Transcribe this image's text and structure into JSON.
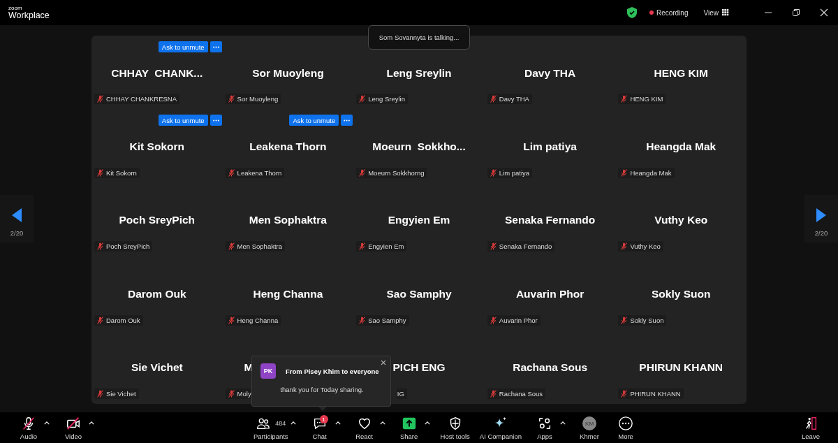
{
  "app": {
    "logo_small": "zoom",
    "logo": "Workplace"
  },
  "top_bar": {
    "secure": true,
    "recording": {
      "label": "Recording",
      "on": true
    },
    "view": "View"
  },
  "talking": "Som Sovannyta is talking...",
  "pager": {
    "left": "2/20",
    "right": "2/20"
  },
  "tiles": [
    {
      "name": "CHHAY  CHANK...",
      "label": "CHHAY CHANKRESNA",
      "muted": true,
      "ask": "Ask to unmute"
    },
    {
      "name": "Sor Muoyleng",
      "label": "Sor Muoyleng",
      "muted": true
    },
    {
      "name": "Leng Sreylin",
      "label": "Leng Sreylin",
      "muted": true
    },
    {
      "name": "Davy THA",
      "label": "Davy THA",
      "muted": true
    },
    {
      "name": "HENG KIM",
      "label": "HENG KIM",
      "muted": true
    },
    {
      "name": "Kit Sokorn",
      "label": "Kit Sokorn",
      "muted": true,
      "ask": "Ask to unmute"
    },
    {
      "name": "Leakena Thorn",
      "label": "Leakena Thorn",
      "muted": true,
      "ask": "Ask to unmute"
    },
    {
      "name": "Moeurn  Sokkho...",
      "label": "Moeurn Sokkhorng",
      "muted": true
    },
    {
      "name": "Lim patiya",
      "label": "Lim patiya",
      "muted": true
    },
    {
      "name": "Heangda Mak",
      "label": "Heangda Mak",
      "muted": true
    },
    {
      "name": "Poch SreyPich",
      "label": "Poch SreyPich",
      "muted": true
    },
    {
      "name": "Men Sophaktra",
      "label": "Men Sophaktra",
      "muted": true
    },
    {
      "name": "Engyien Em",
      "label": "Engyien Em",
      "muted": true
    },
    {
      "name": "Senaka Fernando",
      "label": "Senaka Fernando",
      "muted": true
    },
    {
      "name": "Vuthy Keo",
      "label": "Vuthy Keo",
      "muted": true
    },
    {
      "name": "Darom Ouk",
      "label": "Darom Ouk",
      "muted": true
    },
    {
      "name": "Heng Channa",
      "label": "Heng Channa",
      "muted": true
    },
    {
      "name": "Sao Samphy",
      "label": "Sao Samphy",
      "muted": true
    },
    {
      "name": "Auvarin Phor",
      "label": "Auvarin Phor",
      "muted": true
    },
    {
      "name": "Sokly Suon",
      "label": "Sokly Suon",
      "muted": true
    },
    {
      "name": "Sie Vichet",
      "label": "Sie Vichet",
      "muted": true
    },
    {
      "name": "M",
      "label": "Moly",
      "muted": true,
      "kind": "name_cut"
    },
    {
      "name": "PICH ENG",
      "label": "IG",
      "kind": "label_cut"
    },
    {
      "name": "Rachana Sous",
      "label": "Rachana Sous",
      "muted": true
    },
    {
      "name": "PHIRUN KHANN",
      "label": "PHIRUN KHANN",
      "muted": true
    }
  ],
  "chat_popup": {
    "initials": "PK",
    "color": "#8e44c4",
    "title": "From Pisey Khim to everyone",
    "message": "thank you for Today sharing."
  },
  "toolbar": {
    "left": [
      {
        "kind": "audio",
        "label": "Audio",
        "muted": true,
        "menu": true
      },
      {
        "kind": "video",
        "label": "Video",
        "muted": true,
        "menu": true
      }
    ],
    "center": [
      {
        "kind": "participants",
        "label": "Participants",
        "count": "484",
        "menu": true
      },
      {
        "kind": "chat",
        "label": "Chat",
        "badge": "1",
        "menu": true
      },
      {
        "kind": "react",
        "label": "React",
        "menu": true
      },
      {
        "kind": "share",
        "label": "Share",
        "menu": true
      },
      {
        "kind": "host",
        "label": "Host tools",
        "menu": false
      },
      {
        "kind": "ai",
        "label": "AI Companion",
        "menu": false
      },
      {
        "kind": "apps",
        "label": "Apps",
        "menu": true
      },
      {
        "kind": "avatar",
        "label": "Khmer",
        "initials": "KM",
        "menu": false
      },
      {
        "kind": "more",
        "label": "More",
        "menu": false
      }
    ],
    "right": [
      {
        "kind": "leave",
        "label": "Leave"
      }
    ]
  }
}
